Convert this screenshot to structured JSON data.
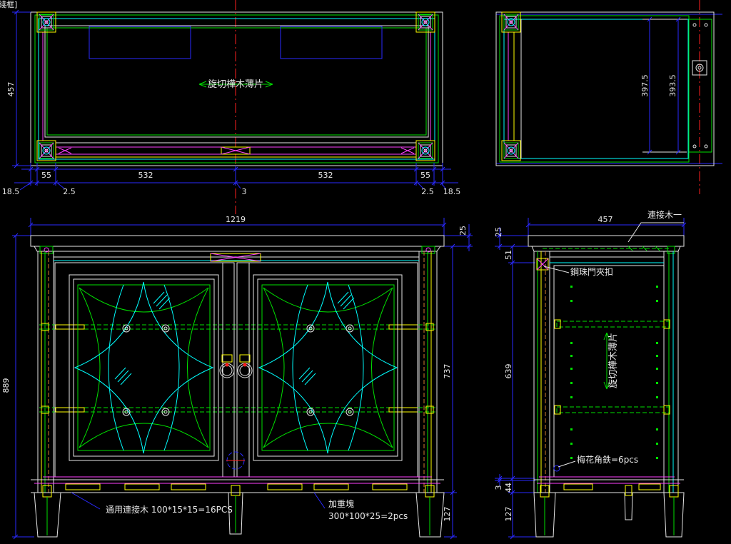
{
  "viewport": {
    "visual_style_label": "綫框]"
  },
  "colors": {
    "background": "#000000",
    "white": "#e6e6e6",
    "green": "#00e000",
    "cyan": "#00ffff",
    "magenta": "#ff40ff",
    "yellow": "#ffff00",
    "blue": "#2a2aff",
    "red": "#ff2020",
    "orange": "#d08030"
  },
  "top_view": {
    "label": "旋切樺木薄片",
    "dims": {
      "depth": "457",
      "left_post": "55",
      "left_span": "532",
      "right_span": "532",
      "right_post": "55",
      "left_overhang": "18.5",
      "left_gap": "2.5",
      "center_gap": "3",
      "right_gap": "2.5",
      "right_overhang": "18.5"
    }
  },
  "side_top_view": {
    "dims": {
      "inner_depth_a": "397.5",
      "inner_depth_b": "393.5"
    }
  },
  "front_view": {
    "dims": {
      "width": "1219",
      "top_thickness": "25",
      "overall_height": "889",
      "body_height": "737",
      "leg_height": "127"
    },
    "notes": {
      "connector_block": "通用連接木 100*15*15=16PCS",
      "weight_block_title": "加重塊",
      "weight_block_spec": "300*100*25=2pcs"
    }
  },
  "side_view": {
    "label": "旋切樺木薄片",
    "dims": {
      "depth": "457",
      "top_thickness": "25",
      "top_rail": "51",
      "body_height": "639",
      "bottom_gap": "3",
      "bottom_rail": "44",
      "leg_height": "127"
    },
    "notes": {
      "connector": "連接木一",
      "door_catch": "鋼珠門夾扣",
      "corner_bracket": "梅花角鉄=6pcs"
    }
  }
}
